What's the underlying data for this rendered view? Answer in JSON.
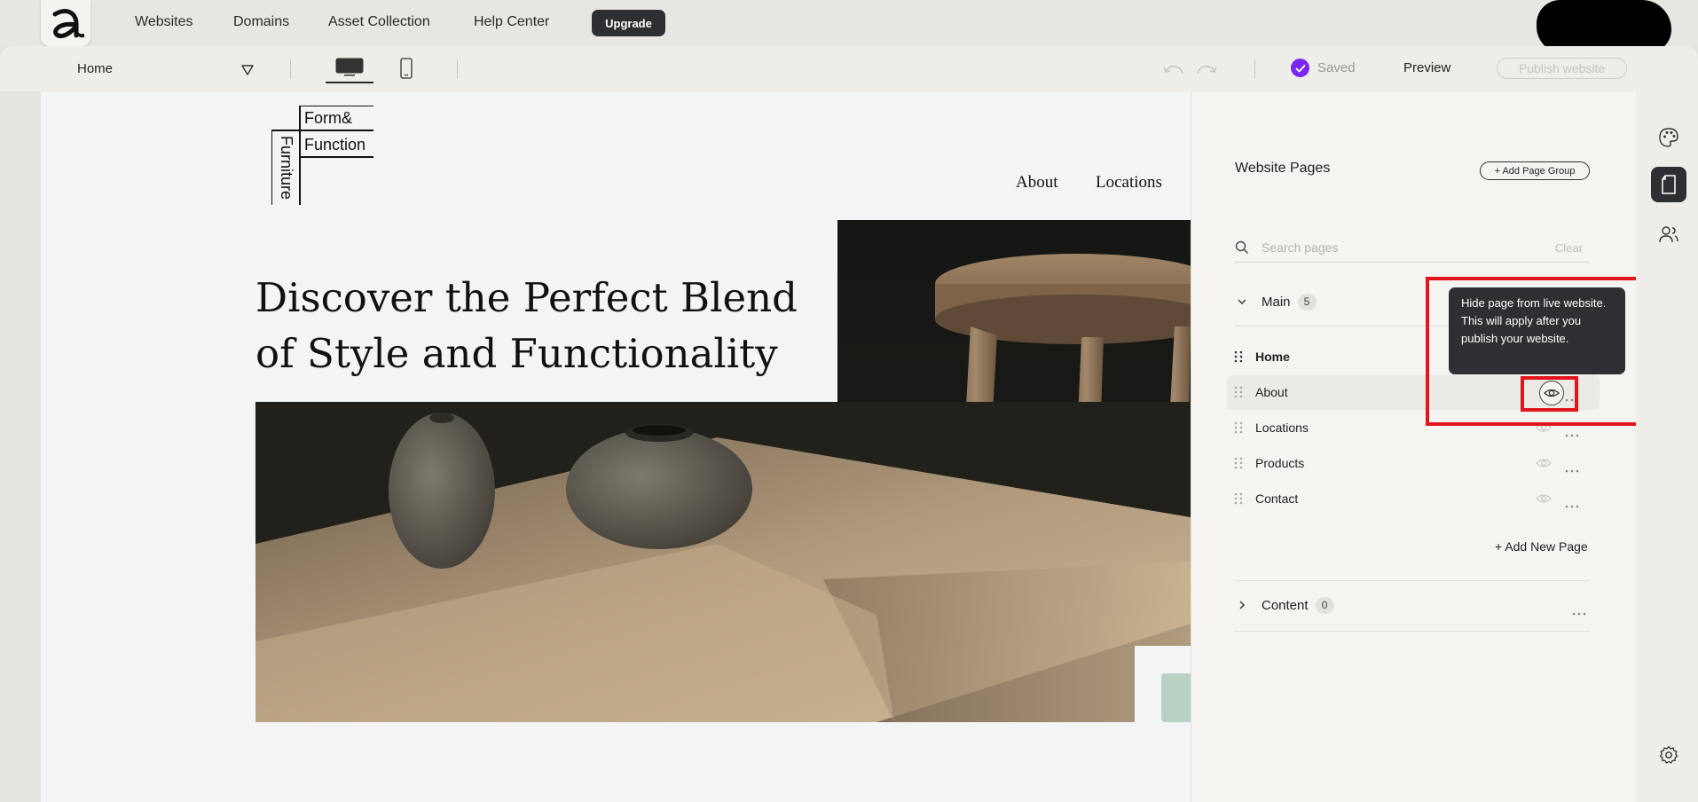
{
  "topnav": {
    "links": [
      "Websites",
      "Domains",
      "Asset Collection",
      "Help Center"
    ],
    "upgrade_label": "Upgrade"
  },
  "toolbar": {
    "page_select": "Home",
    "saved_label": "Saved",
    "preview_label": "Preview",
    "publish_label": "Publish website"
  },
  "site": {
    "logo": {
      "line1": "Form&",
      "line2": "Function",
      "vertical": "Furniture"
    },
    "nav": [
      "About",
      "Locations"
    ],
    "hero_title": "Discover the Perfect Blend of Style and Functionality"
  },
  "panel": {
    "title": "Website Pages",
    "add_group_label": "+ Add Page Group",
    "search_placeholder": "Search pages",
    "search_clear": "Clear",
    "groups": [
      {
        "name": "Main",
        "count": "5"
      },
      {
        "name": "Content",
        "count": "0"
      }
    ],
    "pages": [
      "Home",
      "About",
      "Locations",
      "Products",
      "Contact"
    ],
    "add_page_label": "+ Add New Page",
    "tooltip": "Hide page from live website. This will apply after you publish your website."
  },
  "colors": {
    "accent_saved": "#7a28f0",
    "highlight": "#e2141c",
    "dark_ui": "#2e2f33"
  }
}
